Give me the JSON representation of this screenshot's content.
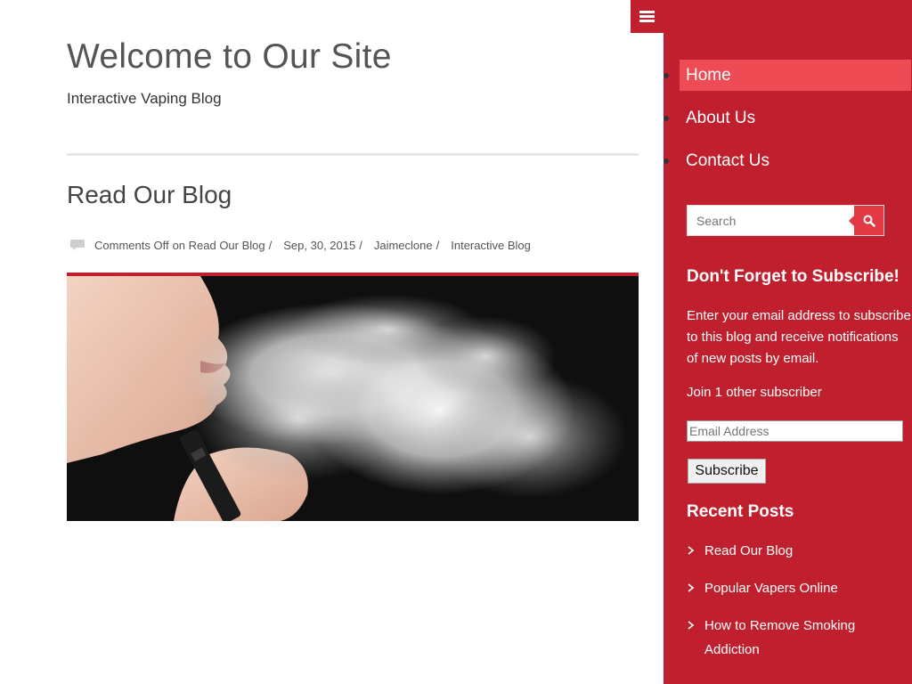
{
  "site": {
    "title": "Welcome to Our Site",
    "tagline": "Interactive Vaping Blog"
  },
  "post": {
    "title": "Read Our Blog",
    "meta": {
      "comments": "Comments Off",
      "comments_on": "on Read Our Blog",
      "date": "Sep, 30, 2015",
      "author": "Jaimeclone",
      "category": "Interactive Blog"
    }
  },
  "nav": {
    "items": [
      {
        "label": "Home"
      },
      {
        "label": "About Us"
      },
      {
        "label": "Contact Us"
      }
    ]
  },
  "search": {
    "placeholder": "Search"
  },
  "subscribe": {
    "title": "Don't Forget to Subscribe!",
    "description": "Enter your email address to subscribe to this blog and receive notifications of new posts by email.",
    "count_text": "Join 1 other subscriber",
    "email_placeholder": "Email Address",
    "button_label": "Subscribe"
  },
  "recent_posts": {
    "title": "Recent Posts",
    "items": [
      {
        "label": "Read Our Blog"
      },
      {
        "label": "Popular Vapers Online"
      },
      {
        "label": "How to Remove Smoking Addiction"
      }
    ]
  },
  "colors": {
    "accent": "#c0202e",
    "active_nav": "#ee4b55",
    "search_button": "#e23a45"
  },
  "icons": [
    "menu-icon",
    "comment-icon",
    "search-icon",
    "chevron-right-icon"
  ]
}
